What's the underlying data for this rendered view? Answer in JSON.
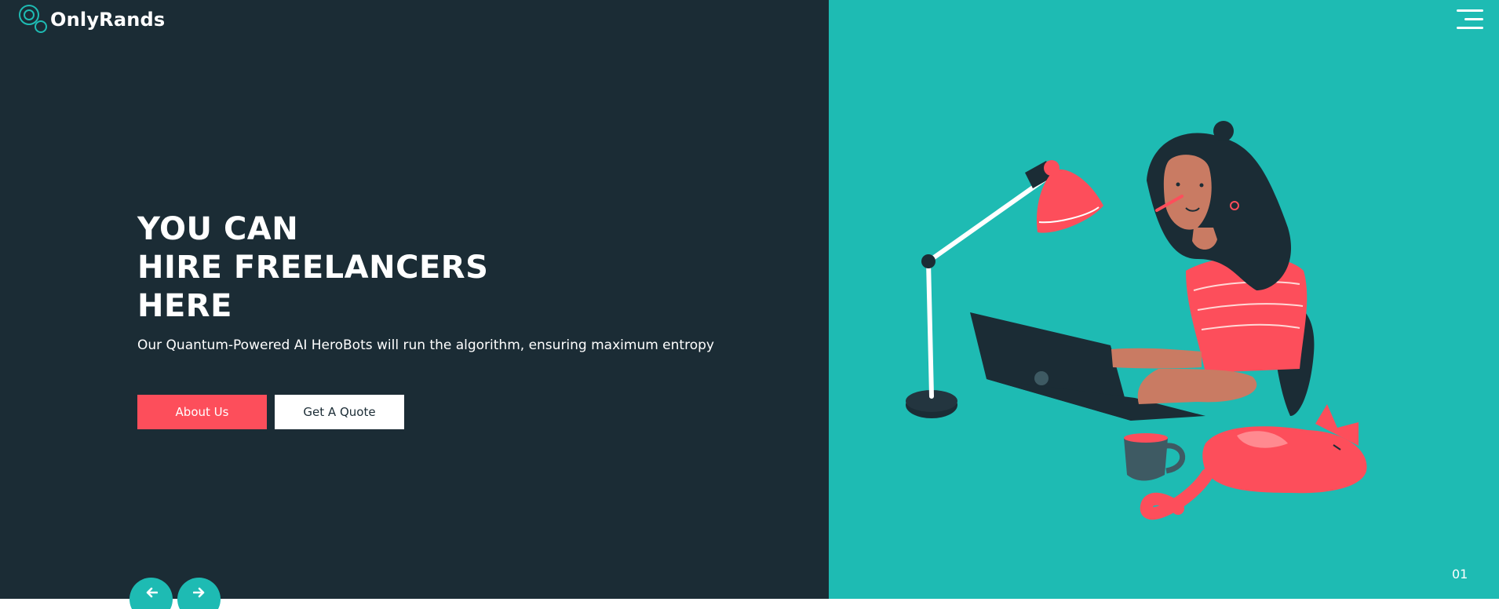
{
  "brand": {
    "name": "OnlyRands"
  },
  "hero": {
    "headline": [
      "YOU CAN",
      "HIRE FREELANCERS",
      "HERE"
    ],
    "subtitle": "Our Quantum-Powered AI HeroBots will run the algorithm, ensuring maximum entropy",
    "buttons": {
      "about": "About Us",
      "quote": "Get A Quote"
    },
    "slide_number": "01"
  },
  "icons": {
    "menu": "hamburger-menu-icon",
    "prev": "arrow-left-icon",
    "next": "arrow-right-icon",
    "logo": "circles-logo-icon"
  },
  "colors": {
    "dark": "#1b2c35",
    "teal": "#1ebbb3",
    "coral": "#fd4e5b",
    "white": "#ffffff"
  }
}
